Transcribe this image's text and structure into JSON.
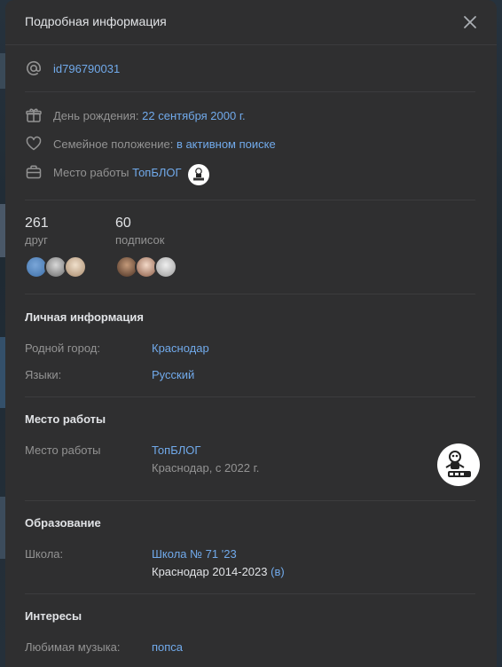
{
  "modal": {
    "title": "Подробная информация"
  },
  "short": {
    "screen_name": "id796790031"
  },
  "details": {
    "birthday_label": "День рождения:",
    "birthday_value": "22 сентября 2000 г.",
    "family_label": "Семейное положение:",
    "family_value": "в активном поиске",
    "work_label": "Место работы",
    "work_value": "ТопБЛОГ"
  },
  "counters": {
    "friends_count": "261",
    "friends_label": "друг",
    "subs_count": "60",
    "subs_label": "подписок"
  },
  "personal": {
    "title": "Личная информация",
    "hometown_label": "Родной город:",
    "hometown_value": "Краснодар",
    "languages_label": "Языки:",
    "languages_value": "Русский"
  },
  "career": {
    "title": "Место работы",
    "label": "Место работы",
    "company": "ТопБЛОГ",
    "location": "Краснодар, с 2022 г."
  },
  "education": {
    "title": "Образование",
    "school_label": "Школа:",
    "school_value": "Школа № 71 '23",
    "school_detail": "Краснодар 2014-2023",
    "school_class": "(в)"
  },
  "interests": {
    "title": "Интересы",
    "music_label": "Любимая музыка:",
    "music_value": "попса"
  },
  "colors": {
    "accent": "#71aaeb",
    "muted": "#939393",
    "bg": "#2f2f30"
  },
  "icons": [
    "at-icon",
    "gift-icon",
    "heart-icon",
    "briefcase-icon",
    "close-icon"
  ]
}
